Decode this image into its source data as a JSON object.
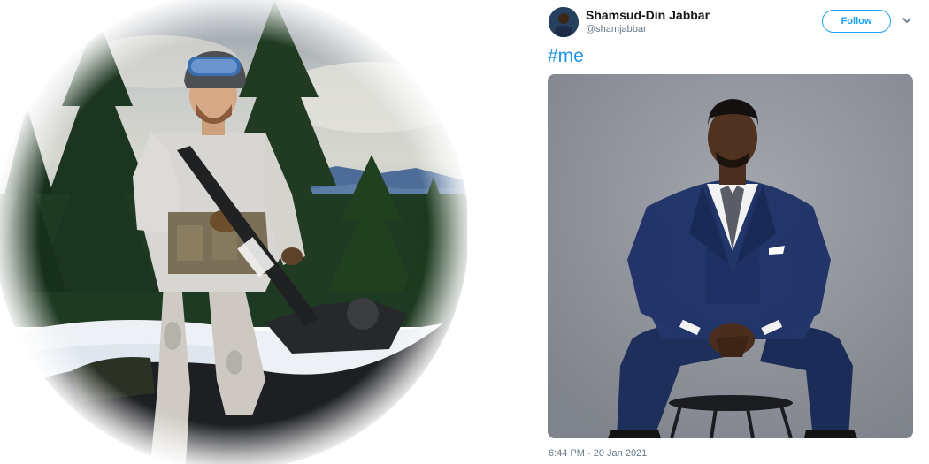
{
  "tweet": {
    "author": {
      "display_name": "Shamsud-Din Jabbar",
      "handle": "@shamjabbar",
      "avatar_icon": "user-avatar"
    },
    "follow_label": "Follow",
    "menu_icon": "chevron-down-icon",
    "text": "#me",
    "timestamp": "6:44 PM - 20 Jan 2021"
  },
  "colors": {
    "accent": "#1da1f2",
    "hashtag": "#1b95e0",
    "muted_text": "#657786"
  }
}
